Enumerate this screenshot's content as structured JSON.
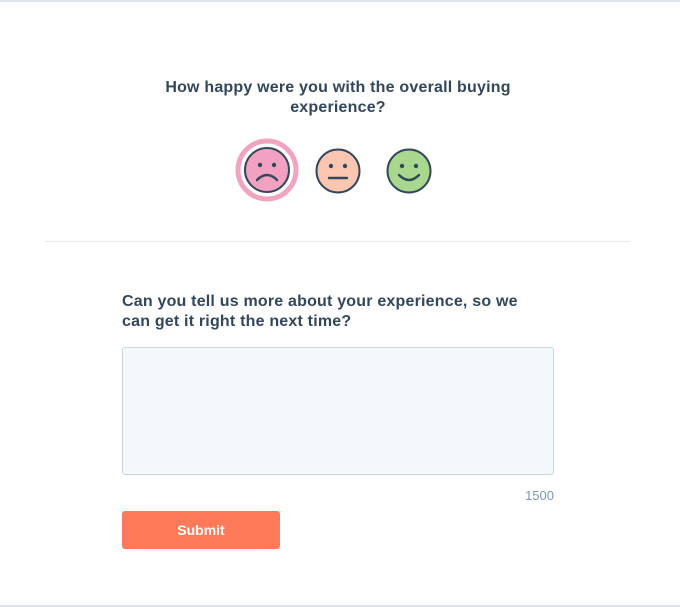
{
  "survey": {
    "question": "How happy were you with the overall buying experience?",
    "ratings": [
      {
        "icon": "sad-face-icon",
        "label": "Unhappy",
        "selected": true,
        "fill": "#f2a2c0",
        "ring": "#f0a4bf"
      },
      {
        "icon": "neutral-face-icon",
        "label": "Neutral",
        "selected": false,
        "fill": "#fcc6b1"
      },
      {
        "icon": "happy-face-icon",
        "label": "Happy",
        "selected": false,
        "fill": "#a8d88e"
      }
    ]
  },
  "followup": {
    "question": "Can you tell us more about your experience, so we can get it right the next time?",
    "textarea_value": "",
    "char_counter": "1500"
  },
  "actions": {
    "submit_label": "Submit"
  },
  "colors": {
    "text": "#33475b",
    "accent": "#ff7a59",
    "face_stroke": "#33475b",
    "counter": "#7c98b6"
  }
}
